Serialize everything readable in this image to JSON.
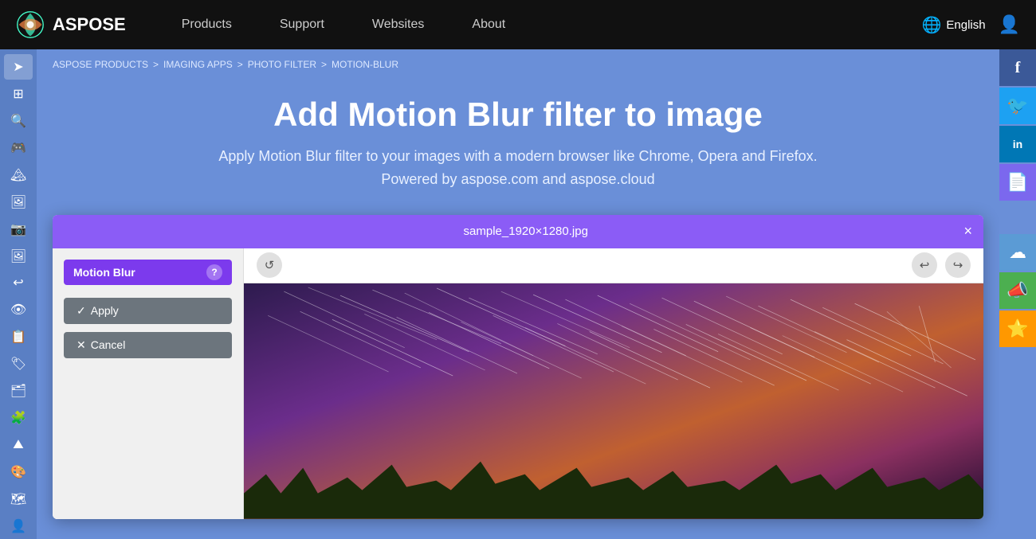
{
  "navbar": {
    "logo_text": "ASPOSE",
    "links": [
      {
        "label": "Products",
        "id": "products"
      },
      {
        "label": "Support",
        "id": "support"
      },
      {
        "label": "Websites",
        "id": "websites"
      },
      {
        "label": "About",
        "id": "about"
      }
    ],
    "language": "English",
    "lang_icon": "🌐"
  },
  "breadcrumb": {
    "items": [
      {
        "label": "ASPOSE PRODUCTS",
        "href": "#"
      },
      {
        "label": "IMAGING APPS",
        "href": "#"
      },
      {
        "label": "PHOTO FILTER",
        "href": "#"
      },
      {
        "label": "MOTION-BLUR",
        "href": "#"
      }
    ],
    "sep": ">"
  },
  "hero": {
    "title": "Add Motion Blur filter to image",
    "subtitle": "Apply Motion Blur filter to your images with a modern browser like Chrome, Opera and Firefox.",
    "subtitle2": "Powered by aspose.com and aspose.cloud"
  },
  "app": {
    "filename": "sample_1920×1280.jpg",
    "close_btn": "×",
    "filter_panel": {
      "title": "Motion Blur",
      "help": "?",
      "apply_btn": "Apply",
      "cancel_btn": "Cancel",
      "apply_icon": "✓",
      "cancel_icon": "✕"
    },
    "toolbar": {
      "refresh_icon": "↺",
      "undo_icon": "↩",
      "redo_icon": "↪"
    }
  },
  "sidebar": {
    "icons": [
      {
        "id": "arrow-right",
        "symbol": "➤"
      },
      {
        "id": "grid",
        "symbol": "⊞"
      },
      {
        "id": "search",
        "symbol": "🔍"
      },
      {
        "id": "gamepad",
        "symbol": "🎮"
      },
      {
        "id": "landscape",
        "symbol": "🏔"
      },
      {
        "id": "image",
        "symbol": "🖼"
      },
      {
        "id": "photo",
        "symbol": "📷"
      },
      {
        "id": "frame",
        "symbol": "🖼"
      },
      {
        "id": "undo",
        "symbol": "↩"
      },
      {
        "id": "eye",
        "symbol": "👁"
      },
      {
        "id": "list",
        "symbol": "📋"
      },
      {
        "id": "sticker",
        "symbol": "🏷"
      },
      {
        "id": "gallery",
        "symbol": "🗂"
      },
      {
        "id": "puzzle",
        "symbol": "🧩"
      },
      {
        "id": "mountain",
        "symbol": "⛰"
      },
      {
        "id": "filter",
        "symbol": "🎨"
      },
      {
        "id": "map",
        "symbol": "🗺"
      },
      {
        "id": "person",
        "symbol": "👤"
      }
    ]
  },
  "social": {
    "buttons": [
      {
        "id": "facebook",
        "symbol": "f",
        "class": "social-fb"
      },
      {
        "id": "twitter",
        "symbol": "🐦",
        "class": "social-tw"
      },
      {
        "id": "linkedin",
        "symbol": "in",
        "class": "social-li"
      },
      {
        "id": "file-share",
        "symbol": "📄",
        "class": "social-file"
      },
      {
        "id": "cloud",
        "symbol": "☁",
        "class": "social-cloud"
      },
      {
        "id": "announce",
        "symbol": "📣",
        "class": "social-announce"
      },
      {
        "id": "star",
        "symbol": "⭐",
        "class": "social-star"
      }
    ]
  },
  "colors": {
    "nav_bg": "#111111",
    "hero_bg": "#6a8fd8",
    "filter_purple": "#7c3aed",
    "header_purple": "#8b5cf6"
  }
}
